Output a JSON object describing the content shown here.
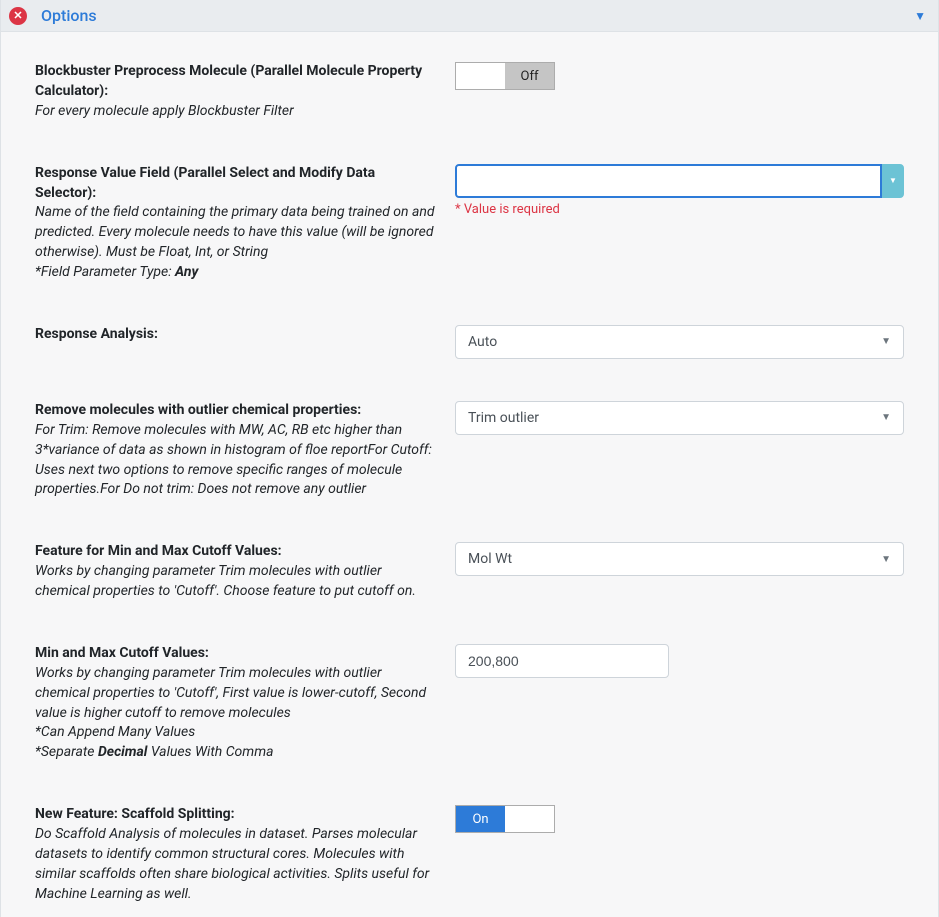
{
  "header": {
    "title": "Options"
  },
  "fields": {
    "preprocess": {
      "label": "Blockbuster Preprocess Molecule (Parallel Molecule Property Calculator):",
      "help": "For every molecule apply Blockbuster Filter",
      "toggle_label": "Off"
    },
    "response_value": {
      "label": "Response Value Field (Parallel Select and Modify Data Selector):",
      "help": "Name of the field containing the primary data being trained on and predicted. Every molecule needs to have this value (will be ignored otherwise). Must be Float, Int, or String",
      "param_type_prefix": "*Field Parameter Type: ",
      "param_type_value": "Any",
      "error": "* Value is required"
    },
    "response_analysis": {
      "label": "Response Analysis:",
      "selected": "Auto"
    },
    "remove_outlier": {
      "label": "Remove molecules with outlier chemical properties:",
      "help": "For Trim: Remove molecules with MW, AC, RB etc higher than 3*variance of data as shown in histogram of floe reportFor Cutoff: Uses next two options to remove specific ranges of molecule properties.For Do not trim: Does not remove any outlier",
      "selected": "Trim outlier"
    },
    "cutoff_feature": {
      "label": "Feature for Min and Max Cutoff Values:",
      "help": "Works by changing parameter Trim molecules with outlier chemical properties to 'Cutoff'. Choose feature to put cutoff on.",
      "selected": "Mol Wt"
    },
    "cutoff_values": {
      "label": "Min and Max Cutoff Values:",
      "help": "Works by changing parameter Trim molecules with outlier chemical properties to 'Cutoff', First value is lower-cutoff, Second value is higher cutoff to remove molecules",
      "note1": "*Can Append Many Values",
      "note2_prefix": "*Separate ",
      "note2_bold": "Decimal",
      "note2_suffix": " Values With Comma",
      "value": "200,800"
    },
    "scaffold": {
      "label": "New Feature: Scaffold Splitting:",
      "help": "Do Scaffold Analysis of molecules in dataset. Parses molecular datasets to identify common structural cores. Molecules with similar scaffolds often share biological activities. Splits useful for Machine Learning as well.",
      "toggle_label": "On"
    }
  }
}
